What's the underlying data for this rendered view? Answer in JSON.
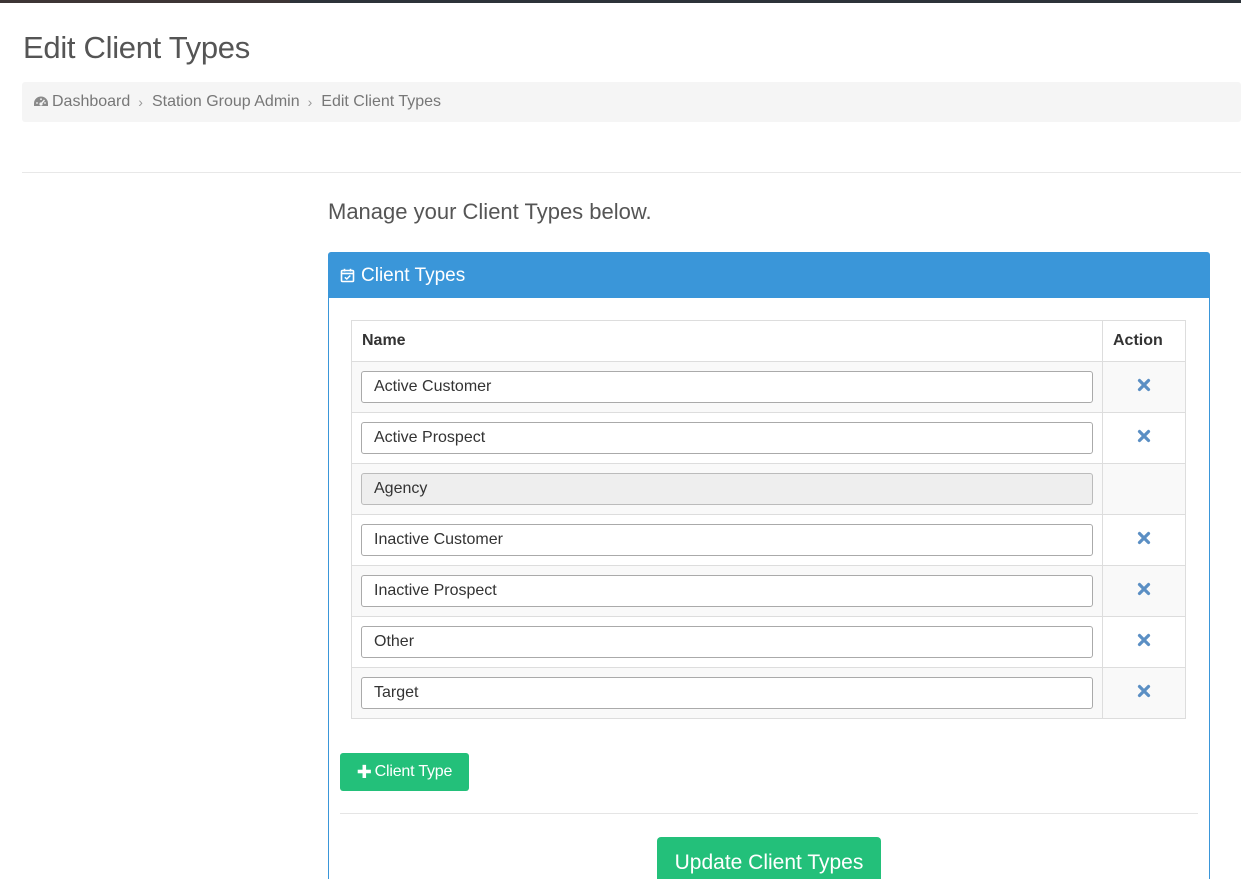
{
  "page": {
    "title": "Edit Client Types",
    "intro": "Manage your Client Types below."
  },
  "breadcrumb": [
    {
      "label": "Dashboard",
      "icon": "dashboard-icon"
    },
    {
      "label": "Station Group Admin"
    },
    {
      "label": "Edit Client Types"
    }
  ],
  "panel": {
    "title": "Client Types",
    "icon": "calendar-check-icon",
    "header_color": "#3a96d9"
  },
  "table": {
    "columns": [
      "Name",
      "Action"
    ],
    "rows": [
      {
        "name": "Active Customer",
        "editable": true,
        "removable": true
      },
      {
        "name": "Active Prospect",
        "editable": true,
        "removable": true
      },
      {
        "name": "Agency",
        "editable": false,
        "removable": false
      },
      {
        "name": "Inactive Customer",
        "editable": true,
        "removable": true
      },
      {
        "name": "Inactive Prospect",
        "editable": true,
        "removable": true
      },
      {
        "name": "Other",
        "editable": true,
        "removable": true
      },
      {
        "name": "Target",
        "editable": true,
        "removable": true
      }
    ]
  },
  "buttons": {
    "add_label": "Client Type",
    "update_label": "Update Client Types",
    "success_color": "#23c07a"
  }
}
